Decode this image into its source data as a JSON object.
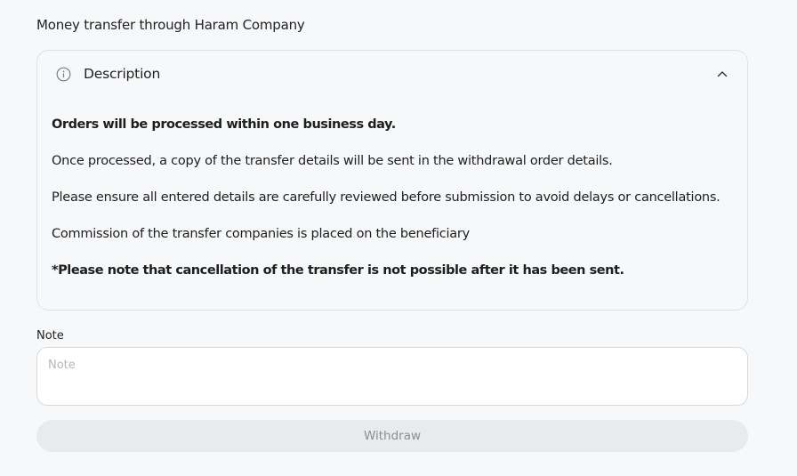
{
  "page": {
    "title": "Money transfer through Haram Company"
  },
  "description": {
    "header_label": "Description",
    "info_icon": "info-circle-icon",
    "toggle_icon": "chevron-up-icon",
    "lines": [
      {
        "text": "Orders will be processed within one business day.",
        "bold": true
      },
      {
        "text": "Once processed, a copy of the transfer details will be sent in the withdrawal order details.",
        "bold": false
      },
      {
        "text": "Please ensure all entered details are carefully reviewed before submission to avoid delays or cancellations.",
        "bold": false
      },
      {
        "text": "Commission of the transfer companies is placed on the beneficiary",
        "bold": false
      },
      {
        "text": "*Please note that cancellation of the transfer is not possible after it has been sent.",
        "bold": true
      }
    ]
  },
  "note": {
    "label": "Note",
    "placeholder": "Note",
    "value": ""
  },
  "actions": {
    "withdraw_label": "Withdraw",
    "withdraw_disabled": true
  },
  "colors": {
    "background": "#f7f8f9",
    "border": "#dfe2e5",
    "button_bg": "#e8eaec",
    "button_text": "#8a8f95",
    "placeholder": "#b3b8be"
  }
}
